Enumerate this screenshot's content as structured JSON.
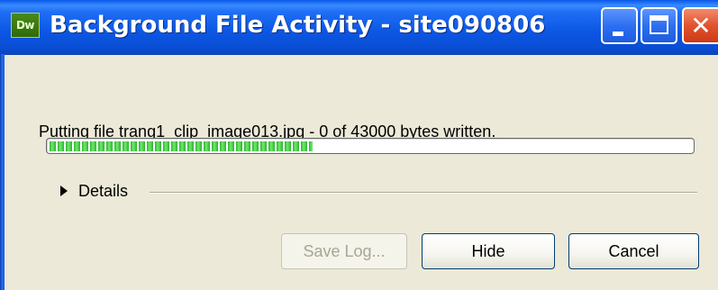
{
  "window": {
    "app_icon_text": "Dw",
    "title": "Background File Activity - site090806",
    "controls": {
      "minimize_icon": "minimize-icon",
      "maximize_icon": "maximize-icon",
      "close_icon": "close-icon",
      "close_glyph": "✕"
    }
  },
  "status": {
    "message": "Putting file trang1_clip_image013.jpg - 0 of 43000 bytes written.",
    "progress_fraction": 0.41
  },
  "details": {
    "label": "Details",
    "expander_icon": "triangle-right-icon"
  },
  "buttons": {
    "save_log": "Save Log...",
    "hide": "Hide",
    "cancel": "Cancel"
  },
  "colors": {
    "titlebar": "#0b56e3",
    "progress_fill": "#2fb12f",
    "dialog_bg": "#ece9d8",
    "close_button": "#e0532e"
  }
}
